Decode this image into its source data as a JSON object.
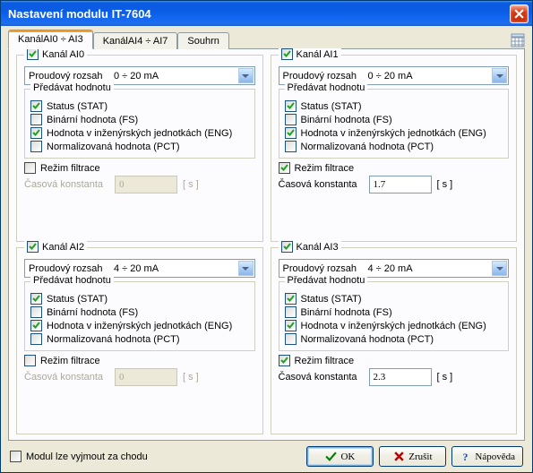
{
  "window": {
    "title": "Nastavení modulu IT-7604"
  },
  "tabs": [
    {
      "label": "KanálAI0 ÷ AI3",
      "active": true
    },
    {
      "label": "KanálAI4 ÷ AI7",
      "active": false
    },
    {
      "label": "Souhrn",
      "active": false
    }
  ],
  "channel_labels": {
    "title_prefix": "Kanál",
    "range_field": "Proudový rozsah",
    "transmit_group": "Předávat hodnotu",
    "status": "Status (STAT)",
    "binary": "Binární hodnota (FS)",
    "eng": "Hodnota v inženýrských jednotkách (ENG)",
    "pct": "Normalizovaná hodnota (PCT)",
    "filter_mode": "Režim filtrace",
    "time_const": "Časová konstanta",
    "unit_s": "[ s ]"
  },
  "channels": [
    {
      "id": "AI0",
      "enabled": true,
      "range": "0 ÷ 20 mA",
      "status": true,
      "binary": false,
      "eng": true,
      "pct": false,
      "filter": false,
      "time_const": "0"
    },
    {
      "id": "AI1",
      "enabled": true,
      "range": "0 ÷ 20 mA",
      "status": true,
      "binary": false,
      "eng": true,
      "pct": false,
      "filter": true,
      "time_const": "1.7"
    },
    {
      "id": "AI2",
      "enabled": true,
      "range": "4 ÷ 20 mA",
      "status": true,
      "binary": false,
      "eng": true,
      "pct": false,
      "filter": false,
      "time_const": "0"
    },
    {
      "id": "AI3",
      "enabled": true,
      "range": "4 ÷ 20 mA",
      "status": true,
      "binary": false,
      "eng": true,
      "pct": false,
      "filter": true,
      "time_const": "2.3"
    }
  ],
  "footer": {
    "hot_swap": "Modul lze vyjmout za chodu",
    "hot_swap_checked": false,
    "ok": "OK",
    "cancel": "Zrušit",
    "help": "Nápověda"
  }
}
